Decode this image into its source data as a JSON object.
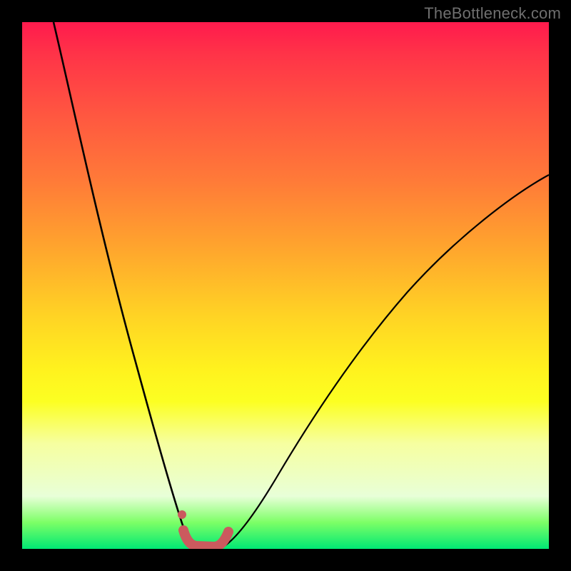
{
  "watermark": "TheBottleneck.com",
  "colors": {
    "frame": "#000000",
    "curve": "#000000",
    "marker_stroke": "#cb5a5e",
    "marker_fill": "#cb5a5e"
  },
  "chart_data": {
    "type": "line",
    "title": "",
    "xlabel": "",
    "ylabel": "",
    "xlim": [
      0,
      100
    ],
    "ylim": [
      0,
      100
    ],
    "background": "rainbow_gradient_red_top_green_bottom",
    "series": [
      {
        "name": "left_branch",
        "x": [
          6,
          10,
          14,
          18,
          22,
          26,
          29,
          30.5,
          32
        ],
        "y": [
          100,
          81,
          62,
          44,
          27,
          13,
          4,
          1,
          0
        ]
      },
      {
        "name": "right_branch",
        "x": [
          37,
          40,
          45,
          52,
          60,
          70,
          82,
          94,
          100
        ],
        "y": [
          0,
          2,
          9,
          20,
          33,
          46,
          58,
          67,
          71
        ]
      },
      {
        "name": "highlighted_region",
        "note": "thick salmon segment along valley floor plus small dot above left edge",
        "x": [
          30.5,
          32,
          34.5,
          37,
          38.5
        ],
        "y": [
          3.2,
          0.4,
          0.2,
          0.6,
          2.8
        ],
        "dot": {
          "x": 30.4,
          "y": 6.8
        }
      }
    ]
  }
}
